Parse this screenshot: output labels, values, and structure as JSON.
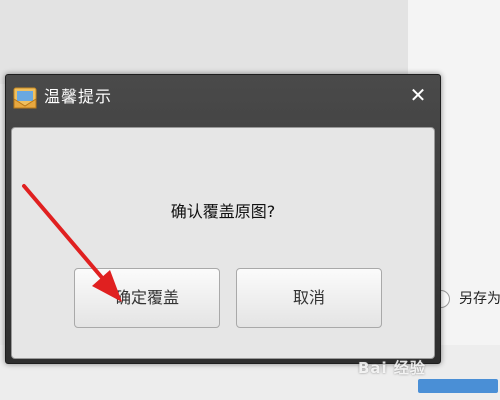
{
  "dialog": {
    "title": "温馨提示",
    "close_glyph": "✕",
    "message": "确认覆盖原图?",
    "confirm_label": "确定覆盖",
    "cancel_label": "取消"
  },
  "background": {
    "radio_option_label": "另存为"
  },
  "watermark": {
    "text": "Bai 经验"
  },
  "icons": {
    "title_icon": "envelope-photo-icon",
    "close_icon": "close-icon",
    "arrow": "red-annotation-arrow"
  },
  "colors": {
    "titlebar": "#3a3a3a",
    "content_bg": "#e6e6e6",
    "arrow_red": "#e02020",
    "watermark_blue": "#4a8fd6"
  }
}
